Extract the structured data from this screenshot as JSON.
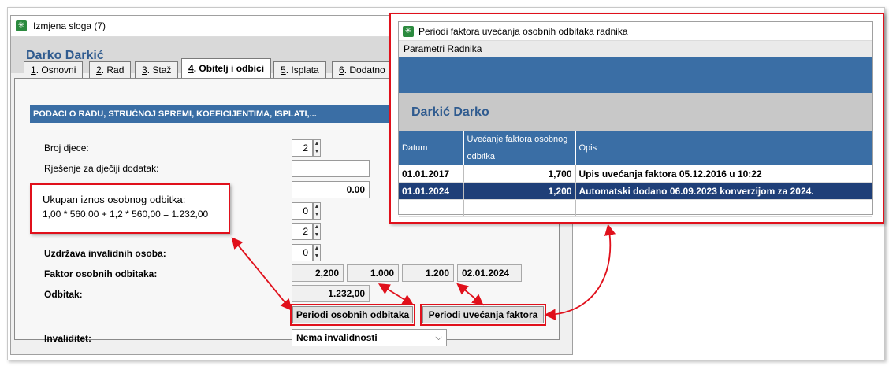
{
  "main_window": {
    "title": "Izmjena sloga (7)",
    "employee_name": "Darko Darkić",
    "tabs": [
      {
        "hotkey": "1",
        "label": ". Osnovni"
      },
      {
        "hotkey": "2",
        "label": ". Rad"
      },
      {
        "hotkey": "3",
        "label": ". Staž"
      },
      {
        "hotkey": "4",
        "label": ". Obitelj i odbici"
      },
      {
        "hotkey": "5",
        "label": ". Isplata"
      },
      {
        "hotkey": "6",
        "label": ". Dodatno"
      }
    ],
    "section_header": "PODACI O RADU, STRUČNOJ SPREMI, KOEFICIJENTIMA, ISPLATI,...",
    "fields": {
      "broj_djece_label": "Broj djece:",
      "broj_djece_value": "2",
      "rjesenje_label": "Rješenje za dječiji dodatak:",
      "rjesenje_value": "",
      "amount_value": "0.00",
      "spin_a_value": "0",
      "spin_b_value": "2",
      "uzdrzava_label": "Uzdržava invalidnih osoba:",
      "uzdrzava_value": "0",
      "faktor_label": "Faktor osobnih odbitaka:",
      "faktor_values": [
        "2,200",
        "1.000",
        "1.200",
        "02.01.2024"
      ],
      "odbitak_label": "Odbitak:",
      "odbitak_value": "1.232,00",
      "invaliditet_label": "Invaliditet:",
      "invaliditet_value": "Nema invalidnosti"
    },
    "buttons": {
      "periodi_odbitaka": "Periodi osobnih odbitaka",
      "periodi_faktora": "Periodi uvećanja faktora"
    }
  },
  "callout": {
    "line1": "Ukupan iznos osobnog odbitka:",
    "line2": "1,00 * 560,00 + 1,2 * 560,00 = 1.232,00"
  },
  "detail_window": {
    "title": "Periodi faktora uvećanja osobnih odbitaka radnika",
    "menu": "Parametri Radnika",
    "employee_name": "Darkić Darko",
    "columns": [
      "Datum",
      "Uvećanje faktora osobnog odbitka",
      "Opis"
    ],
    "rows": [
      {
        "datum": "01.01.2017",
        "faktor": "1,700",
        "opis": "Upis uvećanja faktora 05.12.2016 u 10:22"
      },
      {
        "datum": "01.01.2024",
        "faktor": "1,200",
        "opis": "Automatski dodano 06.09.2023 konverzijom za 2024."
      }
    ]
  },
  "colors": {
    "accent_blue": "#3a6ea5",
    "selected_row": "#1f3f78",
    "highlight_red": "#e0101b",
    "app_icon_green": "#2b8a3e"
  }
}
